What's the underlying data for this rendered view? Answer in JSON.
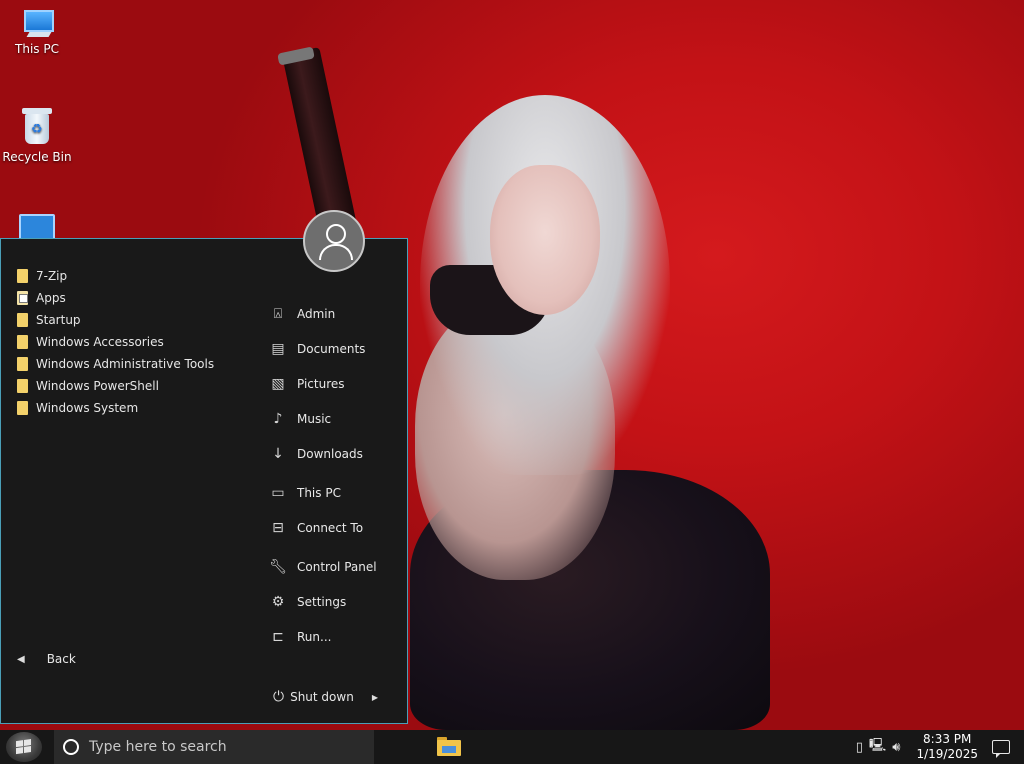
{
  "desktop": {
    "icons": [
      {
        "label": "This PC",
        "icon": "this-pc-icon"
      },
      {
        "label": "Recycle Bin",
        "icon": "recycle-bin-icon"
      },
      {
        "label": "",
        "icon": "control-panel-icon"
      }
    ]
  },
  "start_menu": {
    "programs": [
      {
        "label": "7-Zip",
        "icon": "folder-icon"
      },
      {
        "label": "Apps",
        "icon": "apps-folder-icon"
      },
      {
        "label": "Startup",
        "icon": "folder-icon"
      },
      {
        "label": "Windows Accessories",
        "icon": "folder-icon"
      },
      {
        "label": "Windows Administrative Tools",
        "icon": "folder-icon"
      },
      {
        "label": "Windows PowerShell",
        "icon": "folder-icon"
      },
      {
        "label": "Windows System",
        "icon": "folder-icon"
      }
    ],
    "places": [
      {
        "label": "Admin",
        "icon": "user-folder-icon"
      },
      {
        "label": "Documents",
        "icon": "documents-icon"
      },
      {
        "label": "Pictures",
        "icon": "pictures-icon"
      },
      {
        "label": "Music",
        "icon": "music-icon"
      },
      {
        "label": "Downloads",
        "icon": "downloads-icon"
      },
      {
        "label": "This PC",
        "icon": "computer-icon"
      },
      {
        "label": "Connect To",
        "icon": "connect-to-icon"
      },
      {
        "label": "Control Panel",
        "icon": "wrench-icon"
      },
      {
        "label": "Settings",
        "icon": "gear-icon"
      },
      {
        "label": "Run...",
        "icon": "run-icon"
      }
    ],
    "back_label": "Back",
    "shutdown_label": "Shut down"
  },
  "taskbar": {
    "search_placeholder": "Type here to search",
    "time": "8:33 PM",
    "date": "1/19/2025"
  },
  "colors": {
    "wallpaper": "#c31216",
    "menu_bg": "#191919",
    "menu_border": "#4a9fb8",
    "taskbar_bg": "#171717"
  }
}
